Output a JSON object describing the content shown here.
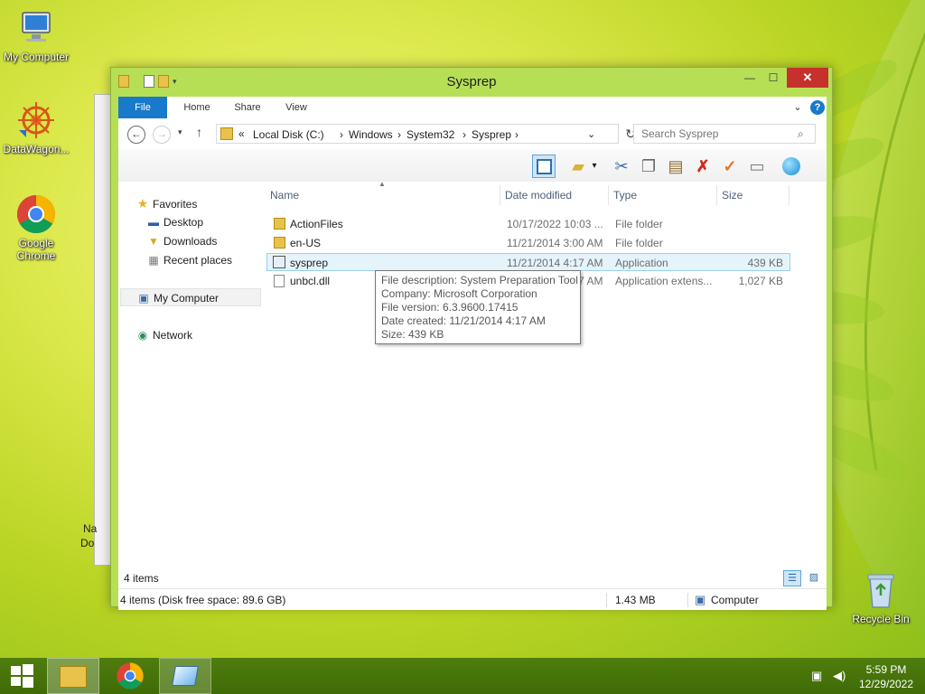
{
  "desktop": {
    "icons": [
      {
        "label": "My Computer",
        "icon": "my-computer-icon"
      },
      {
        "label": "DataWagon...",
        "icon": "datawagon-icon"
      },
      {
        "label": "Google Chrome",
        "icon": "chrome-icon"
      },
      {
        "label": "Recycle Bin",
        "icon": "recycle-bin-icon"
      }
    ],
    "behind_window_text": [
      "Na",
      "Do"
    ]
  },
  "window": {
    "title": "Sysprep",
    "ribbon_tabs": [
      "File",
      "Home",
      "Share",
      "View"
    ],
    "address": {
      "prefix": "«",
      "crumbs": [
        "Local Disk (C:)",
        "Windows",
        "System32",
        "Sysprep"
      ]
    },
    "search_placeholder": "Search Sysprep",
    "nav_pane": {
      "favorites": "Favorites",
      "favorites_items": [
        "Desktop",
        "Downloads",
        "Recent places"
      ],
      "computer": "My Computer",
      "network": "Network"
    },
    "columns": [
      "Name",
      "Date modified",
      "Type",
      "Size"
    ],
    "files": [
      {
        "name": "ActionFiles",
        "date": "10/17/2022 10:03 ...",
        "type": "File folder",
        "size": ""
      },
      {
        "name": "en-US",
        "date": "11/21/2014 3:00 AM",
        "type": "File folder",
        "size": ""
      },
      {
        "name": "sysprep",
        "date": "11/21/2014 4:17 AM",
        "type": "Application",
        "size": "439 KB"
      },
      {
        "name": "unbcl.dll",
        "date": "11/21/2014 4:17 AM",
        "type": "Application extens...",
        "size": "1,027 KB"
      }
    ],
    "tooltip": [
      "File description: System Preparation Tool",
      "Company: Microsoft Corporation",
      "File version: 6.3.9600.17415",
      "Date created: 11/21/2014 4:17 AM",
      "Size: 439 KB"
    ],
    "item_count": "4 items",
    "status": {
      "left": "4 items (Disk free space: 89.6 GB)",
      "size": "1.43 MB",
      "location": "Computer"
    }
  },
  "taskbar": {
    "time": "5:59 PM",
    "date": "12/29/2022"
  }
}
